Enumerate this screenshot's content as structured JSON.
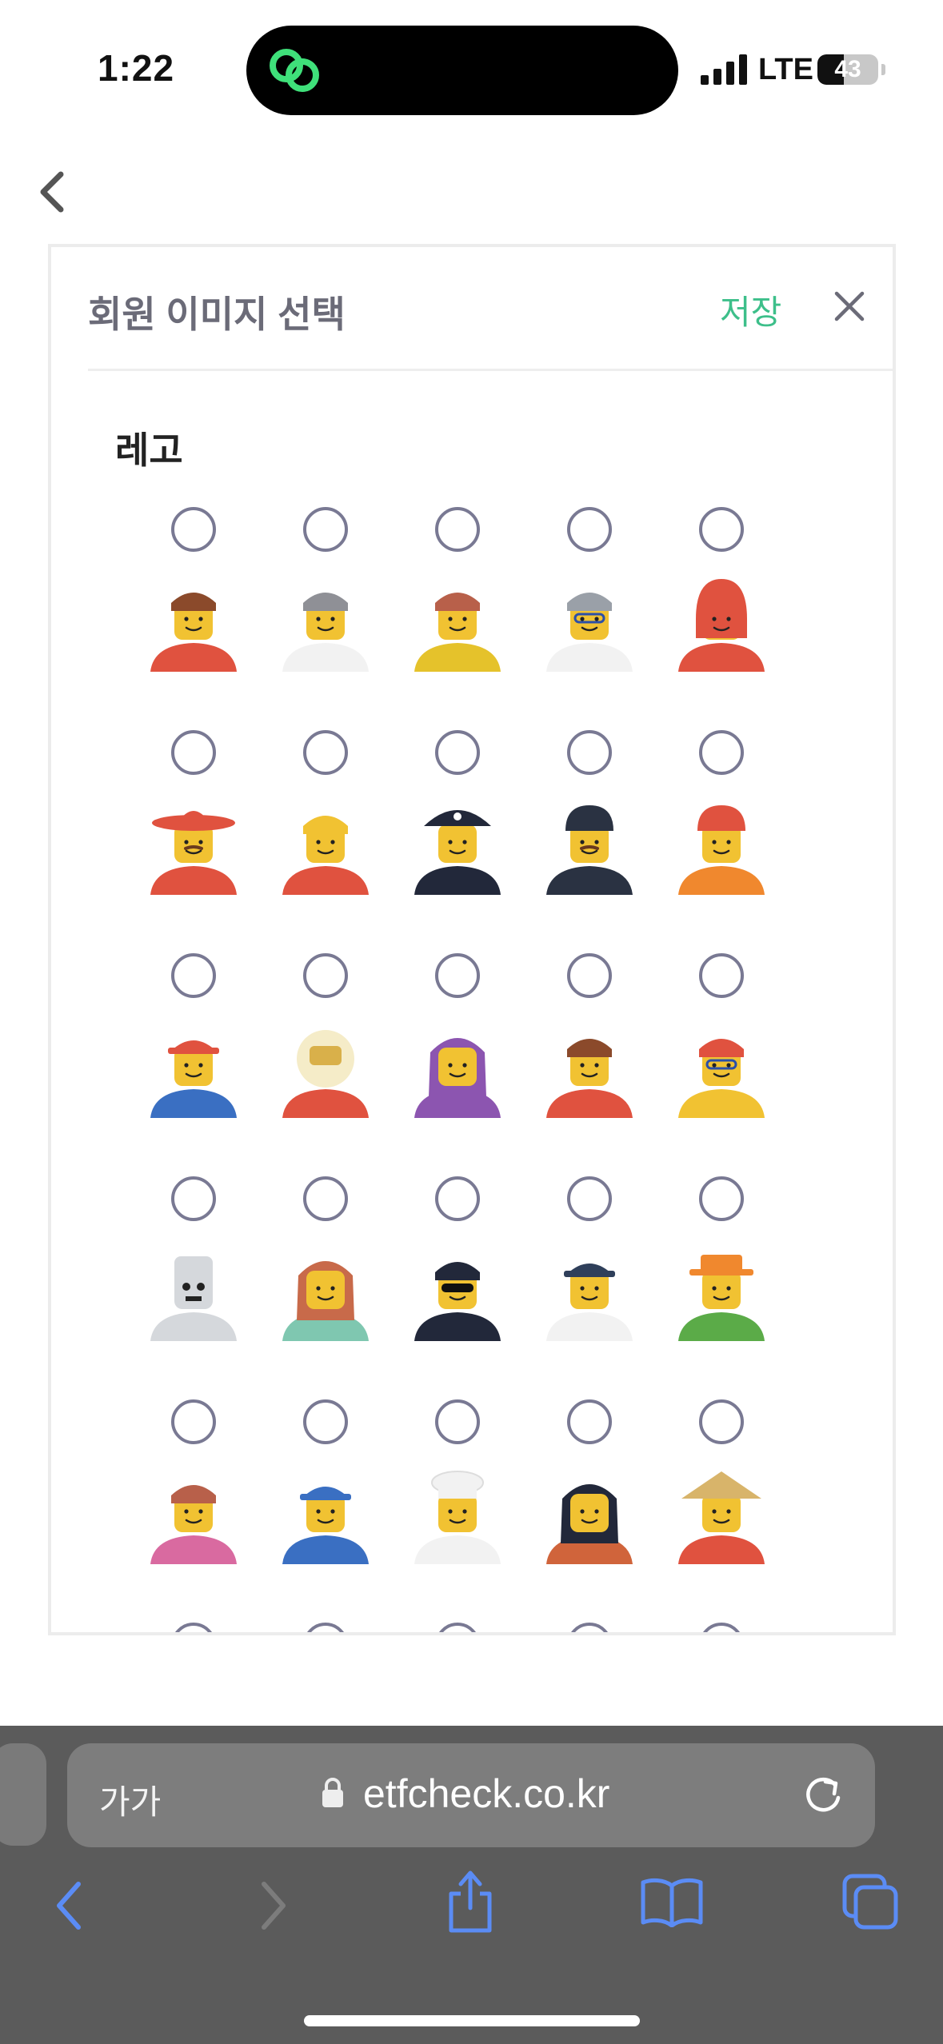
{
  "status_bar": {
    "time": "1:22",
    "network": "LTE",
    "battery_percent": "43",
    "battery_level": 0.43
  },
  "colors": {
    "accent_green": "#3dbf8a",
    "radio_border": "#797993",
    "safari_blue": "#5b8cf5"
  },
  "modal": {
    "title": "회원 이미지 선택",
    "save_label": "저장",
    "close_icon": "close-icon"
  },
  "section": {
    "title": "레고"
  },
  "avatars": [
    {
      "id": "brown-hair",
      "hair": "#8b4a2b",
      "shirt": "#e0523f",
      "acc": "none"
    },
    {
      "id": "beanie",
      "hair": "#8f9096",
      "shirt": "#f2f2f2",
      "acc": "none"
    },
    {
      "id": "pigtails",
      "hair": "#b8604a",
      "shirt": "#e5c22b",
      "acc": "dress"
    },
    {
      "id": "scientist",
      "hair": "#9aa0a8",
      "shirt": "#f2f2f2",
      "acc": "glasses"
    },
    {
      "id": "red-hood",
      "hair": "#e0523f",
      "shirt": "#e0523f",
      "acc": "hood"
    },
    {
      "id": "sombrero",
      "hair": "#e0523f",
      "shirt": "#e0523f",
      "acc": "sombrero"
    },
    {
      "id": "plain",
      "hair": "#f1c232",
      "shirt": "#e0523f",
      "acc": "none"
    },
    {
      "id": "pirate",
      "hair": "#22283a",
      "shirt": "#22283a",
      "acc": "pirate"
    },
    {
      "id": "police",
      "hair": "#2a3242",
      "shirt": "#2a3242",
      "acc": "police"
    },
    {
      "id": "builder",
      "hair": "#e0523f",
      "shirt": "#f0882e",
      "acc": "helmet"
    },
    {
      "id": "red-cap",
      "hair": "#e0523f",
      "shirt": "#3a6fc2",
      "acc": "cap"
    },
    {
      "id": "astronaut",
      "hair": "#f5ecc8",
      "shirt": "#e0523f",
      "acc": "space"
    },
    {
      "id": "purple-hair",
      "hair": "#8c55b0",
      "shirt": "#8c55b0",
      "acc": "long"
    },
    {
      "id": "sporty",
      "hair": "#8b4a2b",
      "shirt": "#e0523f",
      "acc": "none"
    },
    {
      "id": "swimmer",
      "hair": "#e0523f",
      "shirt": "#f1c232",
      "acc": "goggles"
    },
    {
      "id": "skeleton",
      "hair": "#d5d8dc",
      "shirt": "#d5d8dc",
      "acc": "skull"
    },
    {
      "id": "doctor",
      "hair": "#c86a4a",
      "shirt": "#7fc7b0",
      "acc": "long"
    },
    {
      "id": "sunglasses",
      "hair": "#22283a",
      "shirt": "#22283a",
      "acc": "shades"
    },
    {
      "id": "sailor",
      "hair": "#2f3f5a",
      "shirt": "#f2f2f2",
      "acc": "beret"
    },
    {
      "id": "farmer",
      "hair": "#f0882e",
      "shirt": "#5bab48",
      "acc": "hat"
    },
    {
      "id": "bun",
      "hair": "#b8604a",
      "shirt": "#d96aa0",
      "acc": "none"
    },
    {
      "id": "worker-cap",
      "hair": "#3a6fc2",
      "shirt": "#3a6fc2",
      "acc": "cap"
    },
    {
      "id": "chef",
      "hair": "#f2f2f2",
      "shirt": "#f2f2f2",
      "acc": "chef"
    },
    {
      "id": "long-black",
      "hair": "#22283a",
      "shirt": "#d0643b",
      "acc": "long"
    },
    {
      "id": "sage",
      "hair": "#d8b46a",
      "shirt": "#e0523f",
      "acc": "conical"
    }
  ],
  "safari": {
    "text_size_label": "가가",
    "url": "etfcheck.co.kr"
  }
}
